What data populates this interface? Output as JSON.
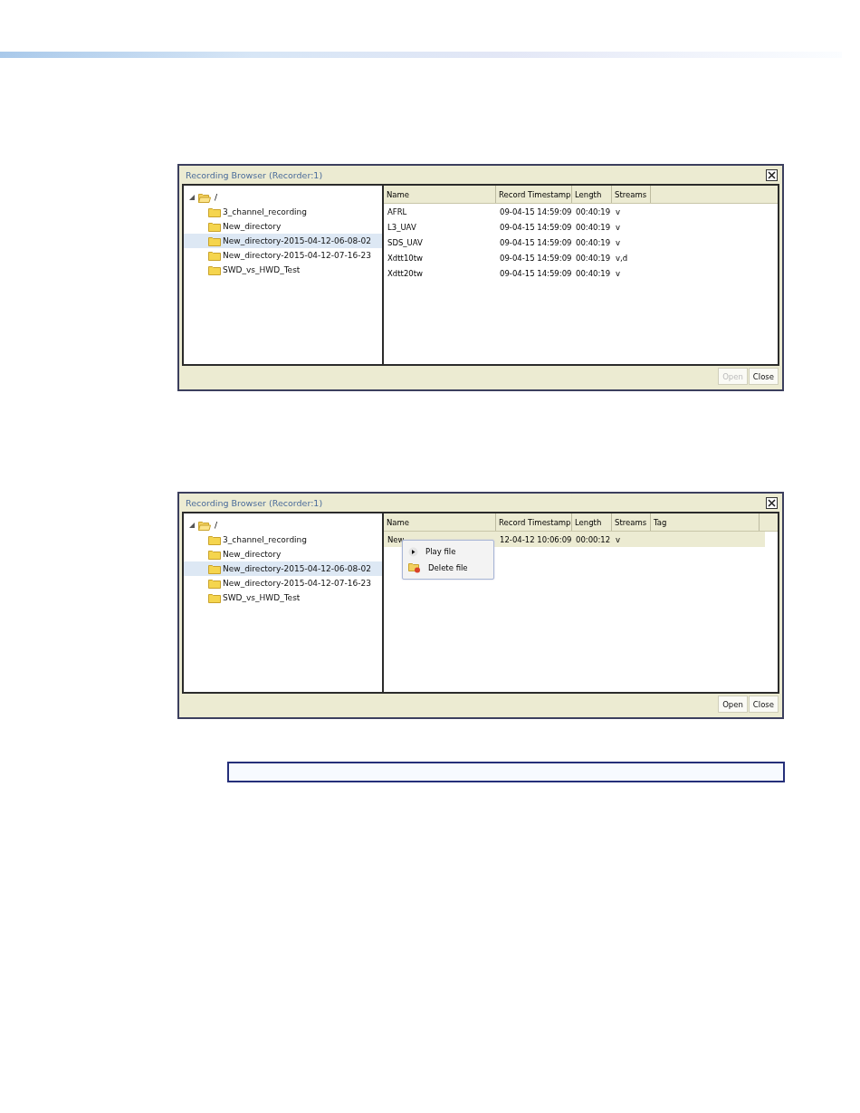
{
  "dialogs": [
    {
      "title": "Recording Browser (Recorder:1)",
      "tree": {
        "label": "/",
        "expanded": true,
        "children": [
          {
            "label": "3_channel_recording",
            "selected": false
          },
          {
            "label": "New_directory",
            "selected": false
          },
          {
            "label": "New_directory-2015-04-12-06-08-02",
            "selected": true
          },
          {
            "label": "New_directory-2015-04-12-07-16-23",
            "selected": false
          },
          {
            "label": "SWD_vs_HWD_Test",
            "selected": false
          }
        ]
      },
      "table": {
        "columns": [
          "Name",
          "Record Timestamp",
          "Length",
          "Streams"
        ],
        "rows": [
          {
            "cells": [
              "AFRL",
              "09-04-15 14:59:09",
              "00:40:19",
              "v"
            ],
            "selected": false
          },
          {
            "cells": [
              "L3_UAV",
              "09-04-15 14:59:09",
              "00:40:19",
              "v"
            ],
            "selected": false
          },
          {
            "cells": [
              "SDS_UAV",
              "09-04-15 14:59:09",
              "00:40:19",
              "v"
            ],
            "selected": false
          },
          {
            "cells": [
              "Xdtt10tw",
              "09-04-15 14:59:09",
              "00:40:19",
              "v,d"
            ],
            "selected": false
          },
          {
            "cells": [
              "Xdtt20tw",
              "09-04-15 14:59:09",
              "00:40:19",
              "v"
            ],
            "selected": false
          }
        ]
      },
      "buttons": [
        {
          "label": "Open",
          "disabled": true
        },
        {
          "label": "Close",
          "disabled": false
        }
      ]
    },
    {
      "title": "Recording Browser (Recorder:1)",
      "tree": {
        "label": "/",
        "expanded": true,
        "children": [
          {
            "label": "3_channel_recording",
            "selected": false
          },
          {
            "label": "New_directory",
            "selected": false
          },
          {
            "label": "New_directory-2015-04-12-06-08-02",
            "selected": true
          },
          {
            "label": "New_directory-2015-04-12-07-16-23",
            "selected": false
          },
          {
            "label": "SWD_vs_HWD_Test",
            "selected": false
          }
        ]
      },
      "table": {
        "columns": [
          "Name",
          "Record Timestamp",
          "Length",
          "Streams",
          "Tag"
        ],
        "rows": [
          {
            "cells": [
              "New",
              "12-04-12 10:06:09",
              "00:00:12",
              "v"
            ],
            "selected": true
          }
        ]
      },
      "context_menu": [
        {
          "kind": "play",
          "label": "Play file"
        },
        {
          "kind": "delete",
          "label": "Delete file"
        }
      ],
      "buttons": [
        {
          "label": "Open",
          "disabled": false
        },
        {
          "label": "Close",
          "disabled": false
        }
      ]
    }
  ]
}
